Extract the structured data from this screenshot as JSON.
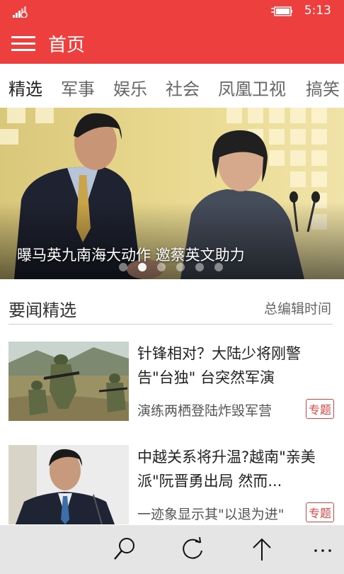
{
  "status": {
    "time": "5:13"
  },
  "header": {
    "title": "首页"
  },
  "tabs": [
    {
      "label": "精选",
      "active": true
    },
    {
      "label": "军事"
    },
    {
      "label": "娱乐"
    },
    {
      "label": "社会"
    },
    {
      "label": "凤凰卫视"
    },
    {
      "label": "搞笑"
    }
  ],
  "hero": {
    "caption": "曝马英九南海大动作 邀蔡英文助力",
    "slide_count": 6,
    "active_slide": 1
  },
  "section": {
    "title": "要闻精选",
    "subtitle": "总编辑时间"
  },
  "news": [
    {
      "title": "针锋相对？大陆少将刚警告\"台独\" 台突然军演",
      "summary": "演练两栖登陆炸毁军营",
      "tag": "专题"
    },
    {
      "title": "中越关系将升温?越南\"亲美派\"阮晋勇出局 然而...",
      "summary": "一迹象显示其\"以退为进\"",
      "tag": "专题"
    }
  ],
  "appbar": {
    "buttons": [
      "search-icon",
      "refresh-icon",
      "scroll-top-icon",
      "more-icon"
    ]
  },
  "colors": {
    "brand": "#ee3f3f",
    "tag": "#e84343",
    "appbar": "#e5e5e5"
  }
}
